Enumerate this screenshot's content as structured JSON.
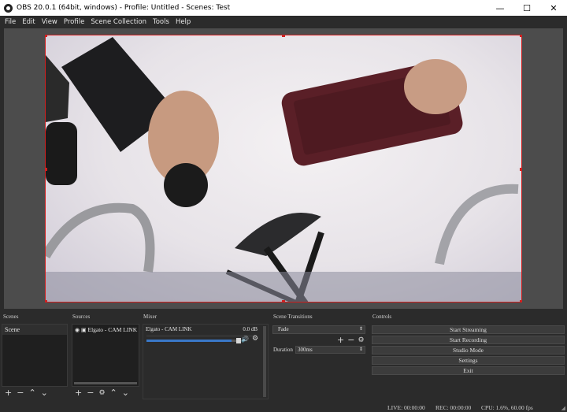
{
  "window": {
    "title": "OBS 20.0.1 (64bit, windows) - Profile: Untitled - Scenes: Test",
    "minimize": "—",
    "maximize": "☐",
    "close": "✕"
  },
  "menu": [
    "File",
    "Edit",
    "View",
    "Profile",
    "Scene Collection",
    "Tools",
    "Help"
  ],
  "docks": {
    "scenes": {
      "title": "Scenes",
      "items": [
        "Scene"
      ]
    },
    "sources": {
      "title": "Sources",
      "items": [
        "Elgato - CAM LINK"
      ]
    },
    "mixer": {
      "title": "Mixer",
      "channel": "Elgato - CAM LINK",
      "level": "0.0 dB",
      "volume_fraction": 0.93
    },
    "transitions": {
      "title": "Scene Transitions",
      "selected": "Fade",
      "duration_label": "Duration",
      "duration_value": "300ms"
    },
    "controls": {
      "title": "Controls",
      "buttons": [
        "Start Streaming",
        "Start Recording",
        "Studio Mode",
        "Settings",
        "Exit"
      ]
    }
  },
  "status": {
    "live": "LIVE: 00:00:00",
    "rec": "REC: 00:00:00",
    "cpu": "CPU: 1.6%, 60.00 fps"
  },
  "icons": {
    "add": "+",
    "remove": "−",
    "up": "⌃",
    "down": "⌄",
    "gear": "⚙",
    "eye": "👁",
    "lock": "🔒",
    "speaker": "🔊"
  },
  "colors": {
    "accent_red": "#d02020",
    "slider_blue": "#3a78c8"
  }
}
